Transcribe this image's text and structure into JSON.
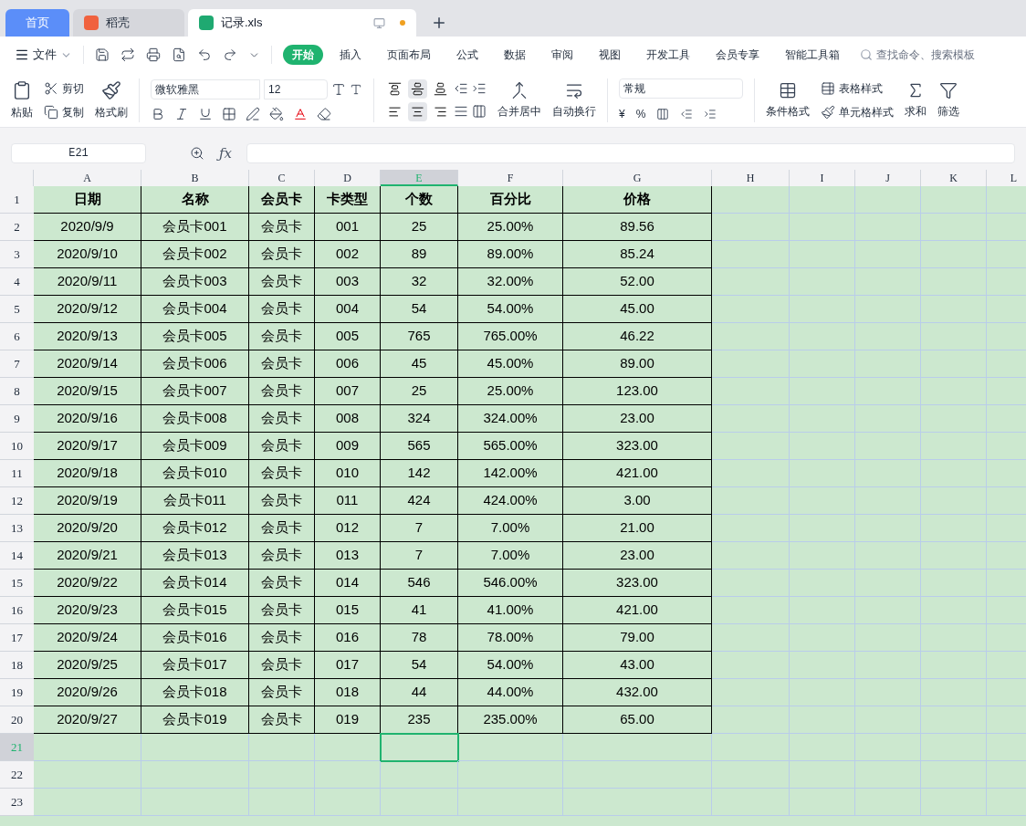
{
  "tabs": [
    {
      "label": "首页",
      "kind": "home",
      "selected": false
    },
    {
      "label": "稻壳",
      "kind": "app",
      "selected": false
    },
    {
      "label": "记录.xls",
      "kind": "doc",
      "selected": true
    }
  ],
  "menu": {
    "file": "文件",
    "items": [
      {
        "label": "开始",
        "selected": true
      },
      {
        "label": "插入",
        "selected": false
      },
      {
        "label": "页面布局",
        "selected": false
      },
      {
        "label": "公式",
        "selected": false
      },
      {
        "label": "数据",
        "selected": false
      },
      {
        "label": "审阅",
        "selected": false
      },
      {
        "label": "视图",
        "selected": false
      },
      {
        "label": "开发工具",
        "selected": false
      },
      {
        "label": "会员专享",
        "selected": false
      },
      {
        "label": "智能工具箱",
        "selected": false
      }
    ],
    "search_placeholder": "查找命令、搜索模板"
  },
  "ribbon": {
    "paste": "粘贴",
    "cut": "剪切",
    "copy": "复制",
    "format_painter": "格式刷",
    "font_name": "微软雅黑",
    "font_size": "12",
    "v_align": [
      {
        "kind": "top",
        "selected": false
      },
      {
        "kind": "middle",
        "selected": true
      },
      {
        "kind": "bottom",
        "selected": false
      }
    ],
    "h_align": [
      {
        "kind": "left",
        "selected": false
      },
      {
        "kind": "center",
        "selected": true
      },
      {
        "kind": "right",
        "selected": false
      }
    ],
    "merge": "合并居中",
    "wrap": "自动换行",
    "number_format": "常规",
    "currency": "¥",
    "percent": "%",
    "conditional": "条件格式",
    "table_style": "表格样式",
    "cell_style": "单元格样式",
    "sum": "求和",
    "filter": "筛选"
  },
  "formula_bar": {
    "name_box": "E21",
    "function_label": "ƒx"
  },
  "columns": [
    {
      "label": "A",
      "selected": false
    },
    {
      "label": "B",
      "selected": false
    },
    {
      "label": "C",
      "selected": false
    },
    {
      "label": "D",
      "selected": false
    },
    {
      "label": "E",
      "selected": true
    },
    {
      "label": "F",
      "selected": false
    },
    {
      "label": "G",
      "selected": false
    },
    {
      "label": "H",
      "selected": false
    },
    {
      "label": "I",
      "selected": false
    },
    {
      "label": "J",
      "selected": false
    },
    {
      "label": "K",
      "selected": false
    },
    {
      "label": "L",
      "selected": false
    }
  ],
  "header": [
    "日期",
    "名称",
    "会员卡",
    "卡类型",
    "个数",
    "百分比",
    "价格"
  ],
  "rows": [
    [
      "2020/9/9",
      "会员卡001",
      "会员卡",
      "001",
      "25",
      "25.00%",
      "89.56"
    ],
    [
      "2020/9/10",
      "会员卡002",
      "会员卡",
      "002",
      "89",
      "89.00%",
      "85.24"
    ],
    [
      "2020/9/11",
      "会员卡003",
      "会员卡",
      "003",
      "32",
      "32.00%",
      "52.00"
    ],
    [
      "2020/9/12",
      "会员卡004",
      "会员卡",
      "004",
      "54",
      "54.00%",
      "45.00"
    ],
    [
      "2020/9/13",
      "会员卡005",
      "会员卡",
      "005",
      "765",
      "765.00%",
      "46.22"
    ],
    [
      "2020/9/14",
      "会员卡006",
      "会员卡",
      "006",
      "45",
      "45.00%",
      "89.00"
    ],
    [
      "2020/9/15",
      "会员卡007",
      "会员卡",
      "007",
      "25",
      "25.00%",
      "123.00"
    ],
    [
      "2020/9/16",
      "会员卡008",
      "会员卡",
      "008",
      "324",
      "324.00%",
      "23.00"
    ],
    [
      "2020/9/17",
      "会员卡009",
      "会员卡",
      "009",
      "565",
      "565.00%",
      "323.00"
    ],
    [
      "2020/9/18",
      "会员卡010",
      "会员卡",
      "010",
      "142",
      "142.00%",
      "421.00"
    ],
    [
      "2020/9/19",
      "会员卡011",
      "会员卡",
      "011",
      "424",
      "424.00%",
      "3.00"
    ],
    [
      "2020/9/20",
      "会员卡012",
      "会员卡",
      "012",
      "7",
      "7.00%",
      "21.00"
    ],
    [
      "2020/9/21",
      "会员卡013",
      "会员卡",
      "013",
      "7",
      "7.00%",
      "23.00"
    ],
    [
      "2020/9/22",
      "会员卡014",
      "会员卡",
      "014",
      "546",
      "546.00%",
      "323.00"
    ],
    [
      "2020/9/23",
      "会员卡015",
      "会员卡",
      "015",
      "41",
      "41.00%",
      "421.00"
    ],
    [
      "2020/9/24",
      "会员卡016",
      "会员卡",
      "016",
      "78",
      "78.00%",
      "79.00"
    ],
    [
      "2020/9/25",
      "会员卡017",
      "会员卡",
      "017",
      "54",
      "54.00%",
      "43.00"
    ],
    [
      "2020/9/26",
      "会员卡018",
      "会员卡",
      "018",
      "44",
      "44.00%",
      "432.00"
    ],
    [
      "2020/9/27",
      "会员卡019",
      "会员卡",
      "019",
      "235",
      "235.00%",
      "65.00"
    ]
  ],
  "row_numbers": [
    {
      "label": "1",
      "selected": false
    },
    {
      "label": "2",
      "selected": false
    },
    {
      "label": "3",
      "selected": false
    },
    {
      "label": "4",
      "selected": false
    },
    {
      "label": "5",
      "selected": false
    },
    {
      "label": "6",
      "selected": false
    },
    {
      "label": "7",
      "selected": false
    },
    {
      "label": "8",
      "selected": false
    },
    {
      "label": "9",
      "selected": false
    },
    {
      "label": "10",
      "selected": false
    },
    {
      "label": "11",
      "selected": false
    },
    {
      "label": "12",
      "selected": false
    },
    {
      "label": "13",
      "selected": false
    },
    {
      "label": "14",
      "selected": false
    },
    {
      "label": "15",
      "selected": false
    },
    {
      "label": "16",
      "selected": false
    },
    {
      "label": "17",
      "selected": false
    },
    {
      "label": "18",
      "selected": false
    },
    {
      "label": "19",
      "selected": false
    },
    {
      "label": "20",
      "selected": false
    },
    {
      "label": "21",
      "selected": true
    },
    {
      "label": "22",
      "selected": false
    },
    {
      "label": "23",
      "selected": false
    }
  ]
}
